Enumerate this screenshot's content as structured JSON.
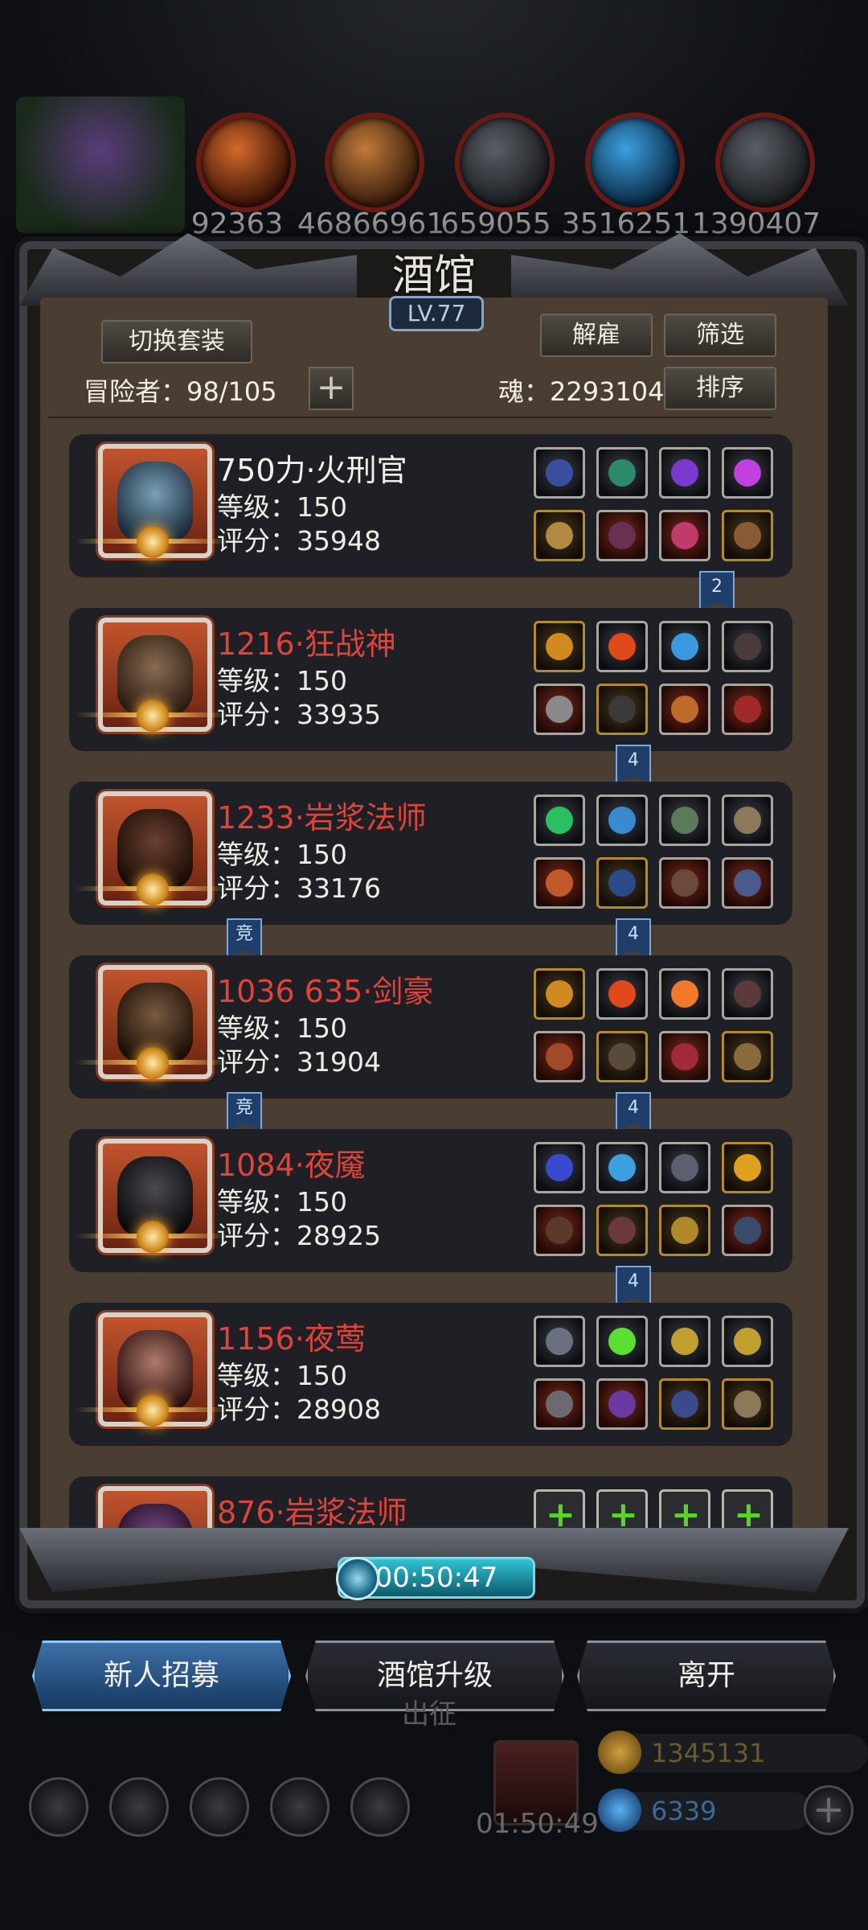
{
  "top_resources": [
    {
      "icon": "crystal-cluster-icon",
      "value": "92363"
    },
    {
      "icon": "meat-icon",
      "value": "46866961"
    },
    {
      "icon": "wood-icon",
      "value": ""
    },
    {
      "icon": "stone-icon",
      "value": "659055"
    },
    {
      "icon": "blue-gem-icon",
      "value": "3516251"
    },
    {
      "icon": "iron-icon",
      "value": "1390407"
    }
  ],
  "tavern": {
    "title": "酒馆",
    "level": "LV.77",
    "switch_outfit_label": "切换套装",
    "dismiss_label": "解雇",
    "filter_label": "筛选",
    "sort_label": "排序",
    "adventurers_label": "冒险者：98/105",
    "soul_label": "魂：2293104"
  },
  "heroes": [
    {
      "name": "750力·火刑官",
      "name_color": "white",
      "level": "等级：150",
      "score": "评分：35948"
    },
    {
      "name": "1216·狂战神",
      "name_color": "red",
      "level": "等级：150",
      "score": "评分：33935"
    },
    {
      "name": "1233·岩浆法师",
      "name_color": "red",
      "level": "等级：150",
      "score": "评分：33176"
    },
    {
      "name": "1036 635·剑豪",
      "name_color": "red",
      "level": "等级：150",
      "score": "评分：31904"
    },
    {
      "name": "1084·夜魇",
      "name_color": "red",
      "level": "等级：150",
      "score": "评分：28925"
    },
    {
      "name": "1156·夜莺",
      "name_color": "red",
      "level": "等级：150",
      "score": "评分：28908"
    },
    {
      "name": "876·岩浆法师",
      "name_color": "red",
      "level": "",
      "score": ""
    }
  ],
  "badges": {
    "b1": "2",
    "b2": "4",
    "b3": "竞",
    "b4": "4",
    "b5": "竞",
    "b6": "4",
    "b7": "4"
  },
  "timer": "00:50:47",
  "buttons": {
    "recruit": "新人招募",
    "upgrade": "酒馆升级",
    "leave": "离开"
  },
  "footer": {
    "march_label": "出征",
    "gift_timer": "01:50:49",
    "gold": "1345131",
    "gems": "6339"
  },
  "colors": {
    "accent_red": "#e0433a",
    "glow_blue": "#3a9cff",
    "add_green": "#5ad22a"
  }
}
